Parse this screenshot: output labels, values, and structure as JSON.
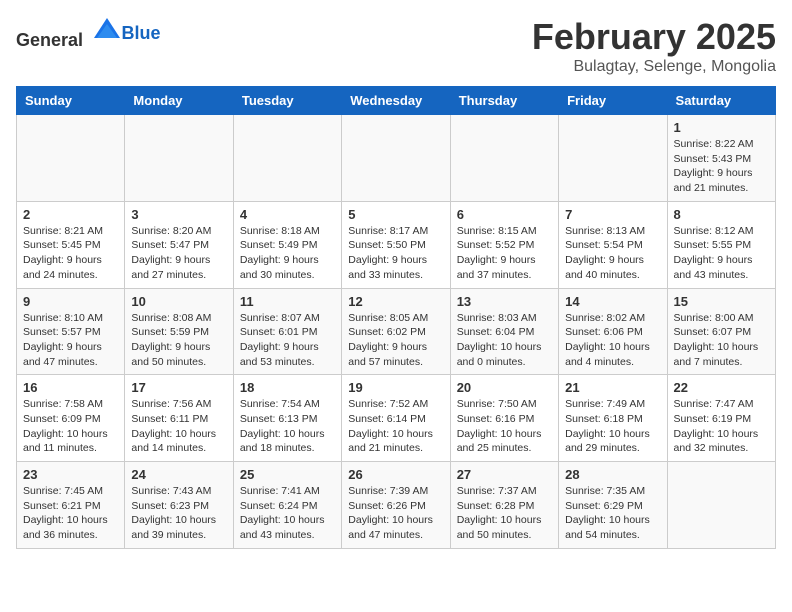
{
  "header": {
    "logo_general": "General",
    "logo_blue": "Blue",
    "title": "February 2025",
    "subtitle": "Bulagtay, Selenge, Mongolia"
  },
  "days_of_week": [
    "Sunday",
    "Monday",
    "Tuesday",
    "Wednesday",
    "Thursday",
    "Friday",
    "Saturday"
  ],
  "weeks": [
    [
      {
        "day": "",
        "info": ""
      },
      {
        "day": "",
        "info": ""
      },
      {
        "day": "",
        "info": ""
      },
      {
        "day": "",
        "info": ""
      },
      {
        "day": "",
        "info": ""
      },
      {
        "day": "",
        "info": ""
      },
      {
        "day": "1",
        "info": "Sunrise: 8:22 AM\nSunset: 5:43 PM\nDaylight: 9 hours and 21 minutes."
      }
    ],
    [
      {
        "day": "2",
        "info": "Sunrise: 8:21 AM\nSunset: 5:45 PM\nDaylight: 9 hours and 24 minutes."
      },
      {
        "day": "3",
        "info": "Sunrise: 8:20 AM\nSunset: 5:47 PM\nDaylight: 9 hours and 27 minutes."
      },
      {
        "day": "4",
        "info": "Sunrise: 8:18 AM\nSunset: 5:49 PM\nDaylight: 9 hours and 30 minutes."
      },
      {
        "day": "5",
        "info": "Sunrise: 8:17 AM\nSunset: 5:50 PM\nDaylight: 9 hours and 33 minutes."
      },
      {
        "day": "6",
        "info": "Sunrise: 8:15 AM\nSunset: 5:52 PM\nDaylight: 9 hours and 37 minutes."
      },
      {
        "day": "7",
        "info": "Sunrise: 8:13 AM\nSunset: 5:54 PM\nDaylight: 9 hours and 40 minutes."
      },
      {
        "day": "8",
        "info": "Sunrise: 8:12 AM\nSunset: 5:55 PM\nDaylight: 9 hours and 43 minutes."
      }
    ],
    [
      {
        "day": "9",
        "info": "Sunrise: 8:10 AM\nSunset: 5:57 PM\nDaylight: 9 hours and 47 minutes."
      },
      {
        "day": "10",
        "info": "Sunrise: 8:08 AM\nSunset: 5:59 PM\nDaylight: 9 hours and 50 minutes."
      },
      {
        "day": "11",
        "info": "Sunrise: 8:07 AM\nSunset: 6:01 PM\nDaylight: 9 hours and 53 minutes."
      },
      {
        "day": "12",
        "info": "Sunrise: 8:05 AM\nSunset: 6:02 PM\nDaylight: 9 hours and 57 minutes."
      },
      {
        "day": "13",
        "info": "Sunrise: 8:03 AM\nSunset: 6:04 PM\nDaylight: 10 hours and 0 minutes."
      },
      {
        "day": "14",
        "info": "Sunrise: 8:02 AM\nSunset: 6:06 PM\nDaylight: 10 hours and 4 minutes."
      },
      {
        "day": "15",
        "info": "Sunrise: 8:00 AM\nSunset: 6:07 PM\nDaylight: 10 hours and 7 minutes."
      }
    ],
    [
      {
        "day": "16",
        "info": "Sunrise: 7:58 AM\nSunset: 6:09 PM\nDaylight: 10 hours and 11 minutes."
      },
      {
        "day": "17",
        "info": "Sunrise: 7:56 AM\nSunset: 6:11 PM\nDaylight: 10 hours and 14 minutes."
      },
      {
        "day": "18",
        "info": "Sunrise: 7:54 AM\nSunset: 6:13 PM\nDaylight: 10 hours and 18 minutes."
      },
      {
        "day": "19",
        "info": "Sunrise: 7:52 AM\nSunset: 6:14 PM\nDaylight: 10 hours and 21 minutes."
      },
      {
        "day": "20",
        "info": "Sunrise: 7:50 AM\nSunset: 6:16 PM\nDaylight: 10 hours and 25 minutes."
      },
      {
        "day": "21",
        "info": "Sunrise: 7:49 AM\nSunset: 6:18 PM\nDaylight: 10 hours and 29 minutes."
      },
      {
        "day": "22",
        "info": "Sunrise: 7:47 AM\nSunset: 6:19 PM\nDaylight: 10 hours and 32 minutes."
      }
    ],
    [
      {
        "day": "23",
        "info": "Sunrise: 7:45 AM\nSunset: 6:21 PM\nDaylight: 10 hours and 36 minutes."
      },
      {
        "day": "24",
        "info": "Sunrise: 7:43 AM\nSunset: 6:23 PM\nDaylight: 10 hours and 39 minutes."
      },
      {
        "day": "25",
        "info": "Sunrise: 7:41 AM\nSunset: 6:24 PM\nDaylight: 10 hours and 43 minutes."
      },
      {
        "day": "26",
        "info": "Sunrise: 7:39 AM\nSunset: 6:26 PM\nDaylight: 10 hours and 47 minutes."
      },
      {
        "day": "27",
        "info": "Sunrise: 7:37 AM\nSunset: 6:28 PM\nDaylight: 10 hours and 50 minutes."
      },
      {
        "day": "28",
        "info": "Sunrise: 7:35 AM\nSunset: 6:29 PM\nDaylight: 10 hours and 54 minutes."
      },
      {
        "day": "",
        "info": ""
      }
    ]
  ]
}
